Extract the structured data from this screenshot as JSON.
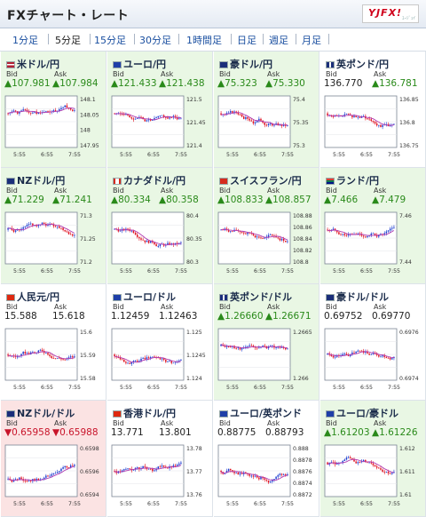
{
  "header": {
    "title": "FXチャート・レート",
    "logo_text": "YJFX!",
    "logo_small": "ﾕｰｼﾞｪｲ"
  },
  "tabs": [
    {
      "label": "1分足",
      "active": false
    },
    {
      "label": "5分足",
      "active": true
    },
    {
      "label": "15分足",
      "active": false
    },
    {
      "label": "30分足",
      "active": false
    },
    {
      "label": "1時間足",
      "active": false
    },
    {
      "label": "日足",
      "active": false
    },
    {
      "label": "週足",
      "active": false
    },
    {
      "label": "月足",
      "active": false
    }
  ],
  "labels": {
    "bid": "Bid",
    "ask": "Ask"
  },
  "time_ticks": [
    "5:55",
    "6:55",
    "7:55"
  ],
  "colors": {
    "green_bg": "#e9f7e4",
    "red_bg": "#fbe3e3",
    "up": "#2a8a1a",
    "down": "#c8142a",
    "ma_line": "#b03ab0"
  },
  "pairs": [
    {
      "name": "米ドル/円",
      "flag": "us",
      "bid": "▲107.981",
      "ask": "▲107.984",
      "trend": "up",
      "bg": "g",
      "yticks": [
        "148.1",
        "148.05",
        "148",
        "147.95"
      ],
      "sig": 1
    },
    {
      "name": "ユーロ/円",
      "flag": "eu",
      "bid": "▲121.433",
      "ask": "▲121.438",
      "trend": "up",
      "bg": "g",
      "yticks": [
        "121.5",
        "121.45",
        "121.4"
      ],
      "sig": 2
    },
    {
      "name": "豪ドル/円",
      "flag": "au",
      "bid": "▲75.323",
      "ask": "▲75.330",
      "trend": "up",
      "bg": "g",
      "yticks": [
        "75.4",
        "75.35",
        "75.3"
      ],
      "sig": 3
    },
    {
      "name": "英ポンド/円",
      "flag": "uk",
      "bid": "136.770",
      "ask": "▲136.781",
      "trend": "up",
      "bidplain": true,
      "bg": "",
      "yticks": [
        "136.85",
        "136.8",
        "136.75"
      ],
      "sig": 4
    },
    {
      "name": "NZドル/円",
      "flag": "nz",
      "bid": "▲71.229",
      "ask": "▲71.241",
      "trend": "up",
      "bg": "g",
      "yticks": [
        "71.3",
        "71.25",
        "71.2"
      ],
      "sig": 5
    },
    {
      "name": "カナダドル/円",
      "flag": "ca",
      "bid": "▲80.334",
      "ask": "▲80.358",
      "trend": "up",
      "bg": "g",
      "yticks": [
        "80.4",
        "80.35",
        "80.3"
      ],
      "sig": 6
    },
    {
      "name": "スイスフラン/円",
      "flag": "ch",
      "bid": "▲108.833",
      "ask": "▲108.857",
      "trend": "up",
      "bg": "g",
      "yticks": [
        "108.88",
        "108.86",
        "108.84",
        "108.82",
        "108.8"
      ],
      "sig": 7
    },
    {
      "name": "ランド/円",
      "flag": "za",
      "bid": "▲7.466",
      "ask": "▲7.479",
      "trend": "up",
      "bg": "g",
      "yticks": [
        "7.46",
        "7.44"
      ],
      "sig": 8
    },
    {
      "name": "人民元/円",
      "flag": "cn",
      "bid": "15.588",
      "ask": "15.618",
      "trend": "flat",
      "bg": "",
      "yticks": [
        "15.6",
        "15.59",
        "15.58"
      ],
      "sig": 9
    },
    {
      "name": "ユーロ/ドル",
      "flag": "eu",
      "bid": "1.12459",
      "ask": "1.12463",
      "trend": "flat",
      "bg": "",
      "yticks": [
        "1.125",
        "1.1245",
        "1.124"
      ],
      "sig": 10
    },
    {
      "name": "英ポンド/ドル",
      "flag": "uk",
      "bid": "▲1.26660",
      "ask": "▲1.26671",
      "trend": "up",
      "bg": "g",
      "yticks": [
        "1.2665",
        "1.266"
      ],
      "sig": 11
    },
    {
      "name": "豪ドル/ドル",
      "flag": "au",
      "bid": "0.69752",
      "ask": "0.69770",
      "trend": "flat",
      "bg": "",
      "yticks": [
        "0.6976",
        "0.6974"
      ],
      "sig": 12
    },
    {
      "name": "NZドル/ドル",
      "flag": "nz",
      "bid": "▼0.65958",
      "ask": "▼0.65988",
      "trend": "down",
      "bg": "r",
      "yticks": [
        "0.6598",
        "0.6596",
        "0.6594"
      ],
      "sig": 13
    },
    {
      "name": "香港ドル/円",
      "flag": "hk",
      "bid": "13.771",
      "ask": "13.801",
      "trend": "flat",
      "bg": "",
      "yticks": [
        "13.78",
        "13.77",
        "13.76"
      ],
      "sig": 14
    },
    {
      "name": "ユーロ/英ポンド",
      "flag": "eu",
      "bid": "0.88775",
      "ask": "0.88793",
      "trend": "flat",
      "bg": "",
      "yticks": [
        "0.888",
        "0.8878",
        "0.8876",
        "0.8874",
        "0.8872"
      ],
      "sig": 15
    },
    {
      "name": "ユーロ/豪ドル",
      "flag": "eu",
      "bid": "▲1.61203",
      "ask": "▲1.61226",
      "trend": "up",
      "bg": "g",
      "yticks": [
        "1.612",
        "1.611",
        "1.61"
      ],
      "sig": 16
    }
  ]
}
